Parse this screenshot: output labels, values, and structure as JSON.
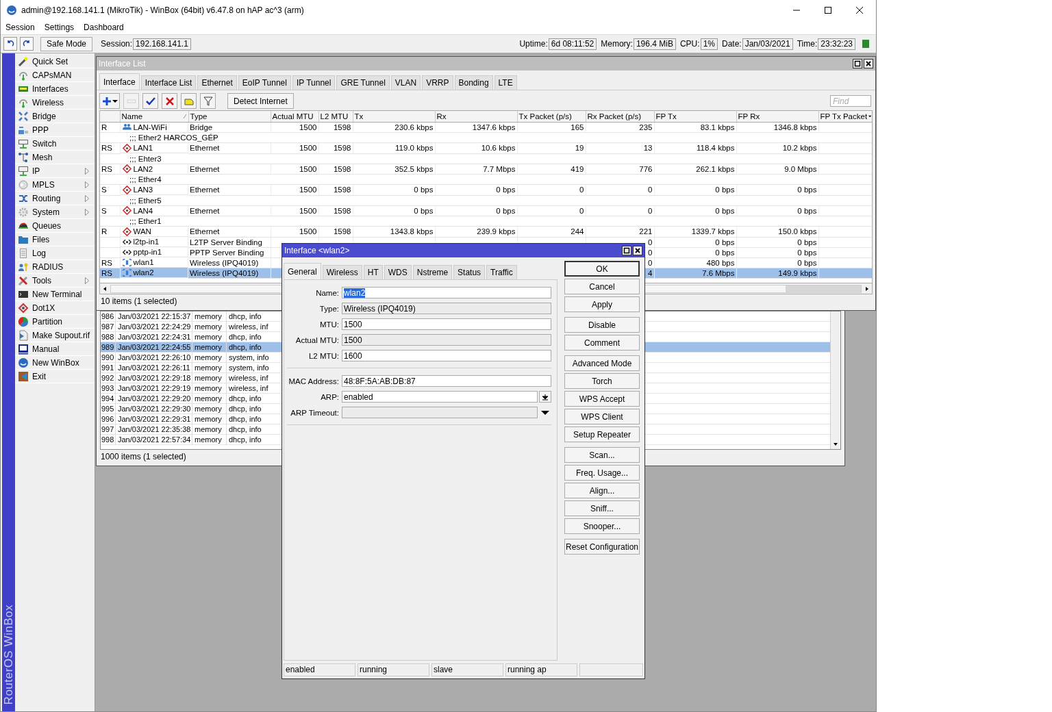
{
  "window": {
    "title": "admin@192.168.141.1 (MikroTik) - WinBox (64bit) v6.47.8 on hAP ac^3 (arm)"
  },
  "menu": [
    "Session",
    "Settings",
    "Dashboard"
  ],
  "toolbar": {
    "safe_mode": "Safe Mode",
    "session_label": "Session:",
    "session": "192.168.141.1",
    "stats": [
      {
        "label": "Uptime:",
        "value": "6d 08:11:52"
      },
      {
        "label": "Memory:",
        "value": "196.4 MiB"
      },
      {
        "label": "CPU:",
        "value": "1%"
      },
      {
        "label": "Date:",
        "value": "Jan/03/2021"
      },
      {
        "label": "Time:",
        "value": "23:32:23"
      }
    ],
    "connected": true
  },
  "sidebar": {
    "brand": "RouterOS WinBox",
    "items": [
      {
        "label": "Quick Set",
        "submenu": false
      },
      {
        "label": "CAPsMAN",
        "submenu": false
      },
      {
        "label": "Interfaces",
        "submenu": false
      },
      {
        "label": "Wireless",
        "submenu": false
      },
      {
        "label": "Bridge",
        "submenu": false
      },
      {
        "label": "PPP",
        "submenu": false
      },
      {
        "label": "Switch",
        "submenu": false
      },
      {
        "label": "Mesh",
        "submenu": false
      },
      {
        "label": "IP",
        "submenu": true
      },
      {
        "label": "MPLS",
        "submenu": true
      },
      {
        "label": "Routing",
        "submenu": true
      },
      {
        "label": "System",
        "submenu": true
      },
      {
        "label": "Queues",
        "submenu": false
      },
      {
        "label": "Files",
        "submenu": false
      },
      {
        "label": "Log",
        "submenu": false
      },
      {
        "label": "RADIUS",
        "submenu": false
      },
      {
        "label": "Tools",
        "submenu": true
      },
      {
        "label": "New Terminal",
        "submenu": false
      },
      {
        "label": "Dot1X",
        "submenu": false
      },
      {
        "label": "Partition",
        "submenu": false
      },
      {
        "label": "Make Supout.rif",
        "submenu": false
      },
      {
        "label": "Manual",
        "submenu": false
      },
      {
        "label": "New WinBox",
        "submenu": false
      },
      {
        "label": "Exit",
        "submenu": false
      }
    ]
  },
  "interface_list": {
    "title": "Interface List",
    "active": false,
    "tabs": [
      {
        "label": "Interface",
        "selected": true
      },
      {
        "label": "Interface List",
        "selected": false
      },
      {
        "label": "Ethernet",
        "selected": false
      },
      {
        "label": "EoIP Tunnel",
        "selected": false
      },
      {
        "label": "IP Tunnel",
        "selected": false
      },
      {
        "label": "GRE Tunnel",
        "selected": false
      },
      {
        "label": "VLAN",
        "selected": false
      },
      {
        "label": "VRRP",
        "selected": false
      },
      {
        "label": "Bonding",
        "selected": false
      },
      {
        "label": "LTE",
        "selected": false
      }
    ],
    "tools": [
      {
        "kind": "add",
        "disabled": false
      },
      {
        "kind": "remove",
        "disabled": true
      },
      {
        "kind": "enable",
        "disabled": false
      },
      {
        "kind": "disable",
        "disabled": false
      },
      {
        "kind": "comment",
        "disabled": false
      },
      {
        "kind": "filter",
        "disabled": false
      },
      {
        "kind": "text",
        "label": "Detect Internet",
        "disabled": false
      }
    ],
    "find": {
      "placeholder": "Find"
    },
    "columns": [
      "Name",
      "Type",
      "Actual MTU",
      "L2 MTU",
      "Tx",
      "Rx",
      "Tx Packet (p/s)",
      "Rx Packet (p/s)",
      "FP Tx",
      "FP Rx",
      "FP Tx Packet"
    ],
    "rows": [
      {
        "kind": "bridge",
        "selected": false,
        "flags": "R",
        "name": "LAN-WiFi",
        "type": "Bridge",
        "cells": [
          "1500",
          "1598",
          "230.6 kbps",
          "1347.6 kbps",
          "165",
          "235",
          "83.1 kbps",
          "1346.8 kbps"
        ]
      },
      {
        "kind": "comment",
        "text": ";;; Ether2 HARCOS_GÉP"
      },
      {
        "kind": "ethernet",
        "selected": false,
        "flags": "RS",
        "name": "LAN1",
        "type": "Ethernet",
        "cells": [
          "1500",
          "1598",
          "119.0 kbps",
          "10.6 kbps",
          "19",
          "13",
          "118.4 kbps",
          "10.2 kbps"
        ]
      },
      {
        "kind": "comment",
        "text": ";;; Ehter3"
      },
      {
        "kind": "ethernet",
        "selected": false,
        "flags": "RS",
        "name": "LAN2",
        "type": "Ethernet",
        "cells": [
          "1500",
          "1598",
          "352.5 kbps",
          "7.7 Mbps",
          "419",
          "776",
          "262.1 kbps",
          "9.0 Mbps"
        ]
      },
      {
        "kind": "comment",
        "text": ";;; Ether4"
      },
      {
        "kind": "ethernet",
        "selected": false,
        "flags": "S",
        "name": "LAN3",
        "type": "Ethernet",
        "cells": [
          "1500",
          "1598",
          "0 bps",
          "0 bps",
          "0",
          "0",
          "0 bps",
          "0 bps"
        ]
      },
      {
        "kind": "comment",
        "text": ";;; Ether5"
      },
      {
        "kind": "ethernet",
        "selected": false,
        "flags": "S",
        "name": "LAN4",
        "type": "Ethernet",
        "cells": [
          "1500",
          "1598",
          "0 bps",
          "0 bps",
          "0",
          "0",
          "0 bps",
          "0 bps"
        ]
      },
      {
        "kind": "comment",
        "text": ";;; Ether1"
      },
      {
        "kind": "ethernet",
        "selected": false,
        "flags": "R",
        "name": "WAN",
        "type": "Ethernet",
        "cells": [
          "1500",
          "1598",
          "1343.8 kbps",
          "239.9 kbps",
          "244",
          "221",
          "1339.7 kbps",
          "150.0 kbps"
        ]
      },
      {
        "kind": "binding",
        "selected": false,
        "name": "l2tp-in1",
        "type": "L2TP Server Binding",
        "cells": [
          null,
          null,
          null,
          null,
          null,
          "0",
          "0 bps",
          "0 bps"
        ]
      },
      {
        "kind": "binding",
        "selected": false,
        "name": "pptp-in1",
        "type": "PPTP Server Binding",
        "cells": [
          null,
          null,
          null,
          null,
          null,
          "0",
          "0 bps",
          "0 bps"
        ]
      },
      {
        "kind": "wireless",
        "selected": false,
        "flags": "RS",
        "name": "wlan1",
        "type": "Wireless (IPQ4019)",
        "cells": [
          null,
          null,
          null,
          null,
          null,
          "0",
          "480 bps",
          "0 bps"
        ]
      },
      {
        "kind": "wireless",
        "selected": true,
        "flags": "RS",
        "name": "wlan2",
        "type": "Wireless (IPQ4019)",
        "cells": [
          null,
          null,
          null,
          null,
          null,
          "4",
          "7.6 Mbps",
          "149.9 kbps"
        ]
      }
    ],
    "status": "10 items (1 selected)"
  },
  "log": {
    "rows": [
      {
        "number": "986",
        "time": "Jan/03/2021 22:15:37",
        "buffer": "memory",
        "topics": "dhcp, info",
        "selected": false
      },
      {
        "number": "987",
        "time": "Jan/03/2021 22:24:29",
        "buffer": "memory",
        "topics": "wireless, inf",
        "selected": false
      },
      {
        "number": "988",
        "time": "Jan/03/2021 22:24:31",
        "buffer": "memory",
        "topics": "dhcp, info",
        "selected": false
      },
      {
        "number": "989",
        "time": "Jan/03/2021 22:24:55",
        "buffer": "memory",
        "topics": "dhcp, info",
        "selected": true
      },
      {
        "number": "990",
        "time": "Jan/03/2021 22:26:10",
        "buffer": "memory",
        "topics": "system, info",
        "selected": false
      },
      {
        "number": "991",
        "time": "Jan/03/2021 22:26:11",
        "buffer": "memory",
        "topics": "system, info",
        "selected": false
      },
      {
        "number": "992",
        "time": "Jan/03/2021 22:29:18",
        "buffer": "memory",
        "topics": "wireless, inf",
        "selected": false
      },
      {
        "number": "993",
        "time": "Jan/03/2021 22:29:19",
        "buffer": "memory",
        "topics": "wireless, inf",
        "selected": false
      },
      {
        "number": "994",
        "time": "Jan/03/2021 22:29:20",
        "buffer": "memory",
        "topics": "dhcp, info",
        "selected": false
      },
      {
        "number": "995",
        "time": "Jan/03/2021 22:29:30",
        "buffer": "memory",
        "topics": "dhcp, info",
        "selected": false
      },
      {
        "number": "996",
        "time": "Jan/03/2021 22:29:31",
        "buffer": "memory",
        "topics": "dhcp, info",
        "selected": false
      },
      {
        "number": "997",
        "time": "Jan/03/2021 22:35:38",
        "buffer": "memory",
        "topics": "dhcp, info",
        "selected": false
      },
      {
        "number": "998",
        "time": "Jan/03/2021 22:57:34",
        "buffer": "memory",
        "topics": "dhcp, info",
        "selected": false
      }
    ],
    "status": "1000 items (1 selected)"
  },
  "dialog": {
    "title": "Interface <wlan2>",
    "active": true,
    "tabs": [
      {
        "label": "General",
        "selected": true
      },
      {
        "label": "Wireless",
        "selected": false
      },
      {
        "label": "HT",
        "selected": false
      },
      {
        "label": "WDS",
        "selected": false
      },
      {
        "label": "Nstreme",
        "selected": false
      },
      {
        "label": "Status",
        "selected": false
      },
      {
        "label": "Traffic",
        "selected": false
      }
    ],
    "field_groups": [
      [
        {
          "label": "Name:",
          "value": "wlan2",
          "kind": "text",
          "text_selected": true
        },
        {
          "label": "Type:",
          "value": "Wireless (IPQ4019)",
          "kind": "readonly",
          "text_selected": false
        },
        {
          "label": "MTU:",
          "value": "1500",
          "kind": "text",
          "text_selected": false
        },
        {
          "label": "Actual MTU:",
          "value": "1500",
          "kind": "readonly",
          "text_selected": false
        },
        {
          "label": "L2 MTU:",
          "value": "1600",
          "kind": "text",
          "text_selected": false
        }
      ],
      [
        {
          "label": "MAC Address:",
          "value": "48:8F:5A:AB:DB:87",
          "kind": "text",
          "text_selected": false
        },
        {
          "label": "ARP:",
          "value": "enabled",
          "kind": "select",
          "text_selected": false
        },
        {
          "label": "ARP Timeout:",
          "kind": "optional"
        }
      ]
    ],
    "button_groups": [
      [
        {
          "label": "OK",
          "default": true
        },
        {
          "label": "Cancel",
          "default": false
        },
        {
          "label": "Apply",
          "default": false
        }
      ],
      [
        {
          "label": "Disable",
          "default": false
        },
        {
          "label": "Comment",
          "default": false
        }
      ],
      [
        {
          "label": "Advanced Mode",
          "default": false
        },
        {
          "label": "Torch",
          "default": false
        },
        {
          "label": "WPS Accept",
          "default": false
        },
        {
          "label": "WPS Client",
          "default": false
        },
        {
          "label": "Setup Repeater",
          "default": false
        }
      ],
      [
        {
          "label": "Scan...",
          "default": false
        },
        {
          "label": "Freq. Usage...",
          "default": false
        },
        {
          "label": "Align...",
          "default": false
        },
        {
          "label": "Sniff...",
          "default": false
        },
        {
          "label": "Snooper...",
          "default": false
        }
      ],
      [
        {
          "label": "Reset Configuration",
          "default": false
        }
      ]
    ],
    "status": [
      "enabled",
      "running",
      "slave",
      "running ap"
    ]
  }
}
